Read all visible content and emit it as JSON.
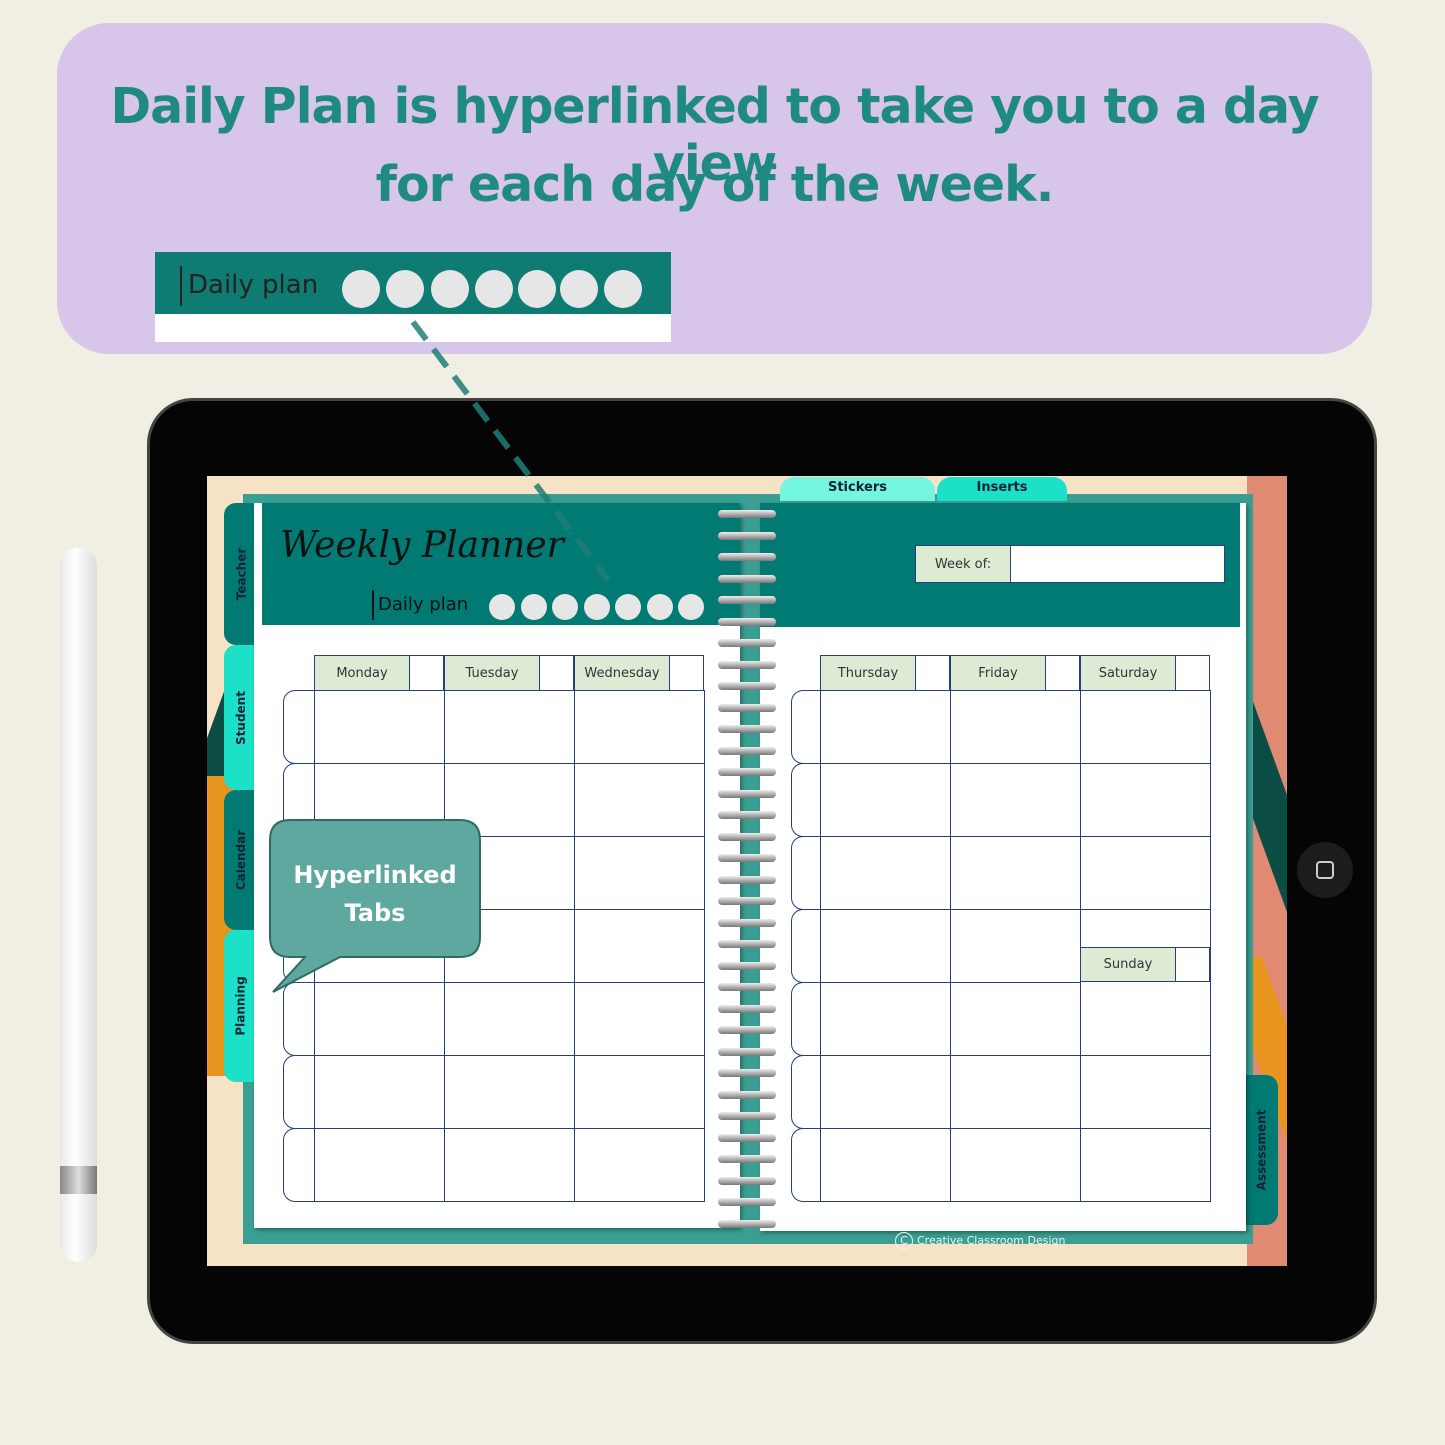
{
  "banner": {
    "line1": "Daily Plan is hyperlinked to take you to a day view",
    "line2": "for each day of the week."
  },
  "inset": {
    "label": "Daily plan",
    "dots": 7
  },
  "planner": {
    "title": "Weekly Planner",
    "daily_plan_label": "Daily plan",
    "week_of_label": "Week of:",
    "week_of_value": "",
    "left_days": [
      "Monday",
      "Tuesday",
      "Wednesday"
    ],
    "right_days": [
      "Thursday",
      "Friday",
      "Saturday"
    ],
    "sunday": "Sunday",
    "side_tabs": [
      "Teacher",
      "Student",
      "Calendar",
      "Planning"
    ],
    "right_tab": "Assessment",
    "top_tabs": [
      "Stickers",
      "Inserts"
    ],
    "copyright": "Creative Classroom Design"
  },
  "callout": {
    "line1": "Hyperlinked",
    "line2": "Tabs"
  },
  "colors": {
    "teal": "#007a73",
    "cyan": "#1de0c8",
    "lavender": "#d7c5ea",
    "headline": "#1f8a80",
    "grid": "#27407a"
  }
}
